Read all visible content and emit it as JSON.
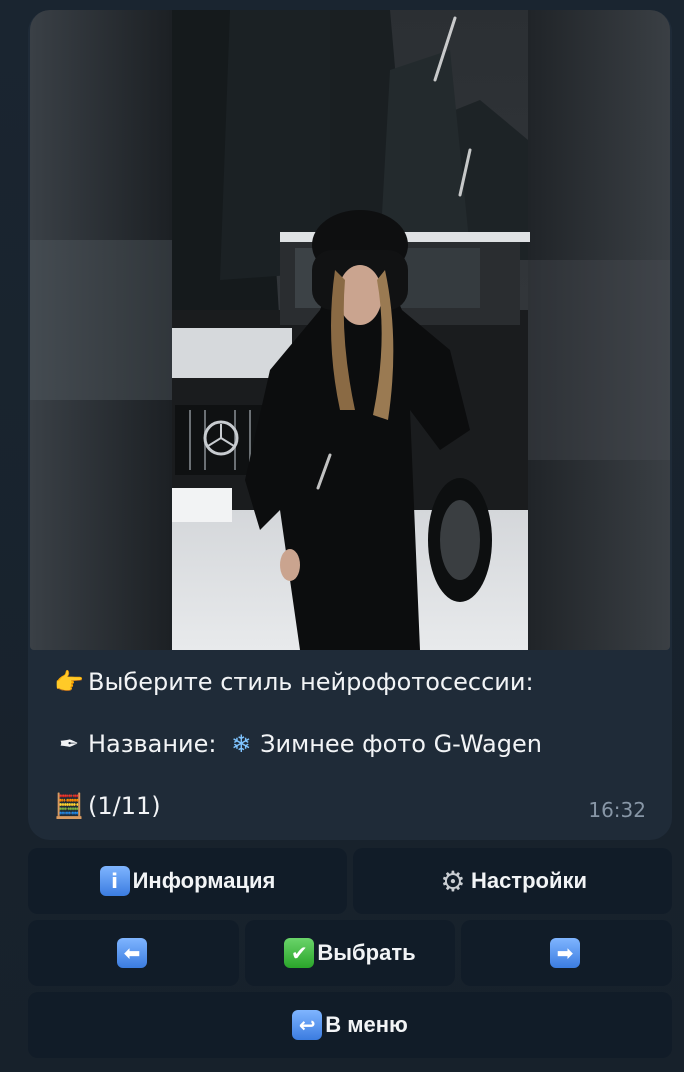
{
  "message": {
    "line1": {
      "icon": "👉",
      "text": "Выберите стиль нейрофотосессии:"
    },
    "line2": {
      "icon": "✒",
      "text": "Название: ",
      "icon2": "❄",
      "value": "Зимнее фото G-Wagen"
    },
    "line3": {
      "icon": "🧮",
      "text": "(1/11)"
    },
    "time": "16:32"
  },
  "buttons": {
    "info": {
      "icon": "i",
      "label": "Информация"
    },
    "settings": {
      "icon": "⚙",
      "label": "Настройки"
    },
    "prev": {
      "icon": "⬅"
    },
    "select": {
      "icon": "✔",
      "label": "Выбрать"
    },
    "next": {
      "icon": "➡"
    },
    "menu": {
      "icon": "↩",
      "label": "В меню"
    }
  },
  "icons": {
    "point": "pointing-hand-icon",
    "pen": "pen-icon",
    "snow": "snowflake-icon",
    "abacus": "abacus-icon",
    "info": "info-icon",
    "settings": "gear-icon",
    "prev": "arrow-left-icon",
    "select": "checkmark-icon",
    "next": "arrow-right-icon",
    "menu": "return-icon"
  }
}
